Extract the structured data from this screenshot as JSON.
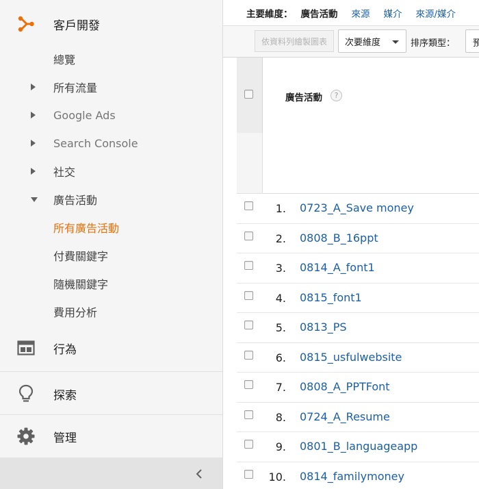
{
  "sidebar": {
    "section_title": "客戶開發",
    "items": [
      {
        "label": "總覽",
        "caret": "none"
      },
      {
        "label": "所有流量",
        "caret": "right"
      },
      {
        "label": "Google Ads",
        "caret": "right"
      },
      {
        "label": "Search Console",
        "caret": "right"
      },
      {
        "label": "社交",
        "caret": "right"
      },
      {
        "label": "廣告活動",
        "caret": "down"
      }
    ],
    "subitems": [
      {
        "label": "所有廣告活動",
        "active": true
      },
      {
        "label": "付費關鍵字",
        "active": false
      },
      {
        "label": "隨機關鍵字",
        "active": false
      },
      {
        "label": "費用分析",
        "active": false
      }
    ],
    "behavior_label": "行為",
    "discover_label": "探索",
    "admin_label": "管理",
    "accent_color": "#e8710a"
  },
  "dimensions": {
    "label": "主要維度：",
    "active": "廣告活動",
    "links": [
      "來源",
      "媒介",
      "來源/媒介"
    ]
  },
  "toolbar": {
    "chart_button": "依資料列繪製圖表",
    "secondary_dimension": "次要維度",
    "sort_type_label": "排序類型：",
    "sort_type_value": "預設"
  },
  "table": {
    "column_header": "廣告活動",
    "help_glyph": "?",
    "rows": [
      {
        "num": "1.",
        "campaign": "0723_A_Save money"
      },
      {
        "num": "2.",
        "campaign": "0808_B_16ppt"
      },
      {
        "num": "3.",
        "campaign": "0814_A_font1"
      },
      {
        "num": "4.",
        "campaign": "0815_font1"
      },
      {
        "num": "5.",
        "campaign": "0813_PS"
      },
      {
        "num": "6.",
        "campaign": "0815_usfulwebsite"
      },
      {
        "num": "7.",
        "campaign": "0808_A_PPTFont"
      },
      {
        "num": "8.",
        "campaign": "0724_A_Resume"
      },
      {
        "num": "9.",
        "campaign": "0801_B_languageapp"
      },
      {
        "num": "10.",
        "campaign": "0814_familymoney"
      }
    ]
  }
}
